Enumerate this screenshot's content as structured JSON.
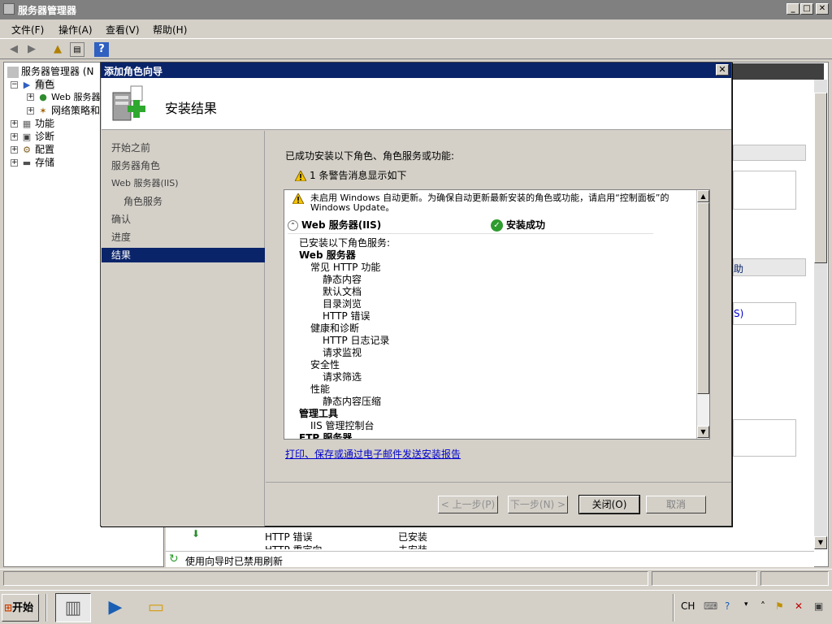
{
  "window": {
    "title": "服务器管理器",
    "menu": [
      "文件(F)",
      "操作(A)",
      "查看(V)",
      "帮助(H)"
    ]
  },
  "tree": {
    "root": "服务器管理器 (N",
    "items": [
      "角色",
      "Web 服务器",
      "网络策略和",
      "功能",
      "诊断",
      "配置",
      "存储"
    ]
  },
  "background": {
    "right_fragment_1": "助",
    "right_fragment_2": "S)",
    "row1_name": "HTTP 错误",
    "row1_status": "已安装",
    "row2_name": "HTTP 重定向",
    "row2_status": "未安装",
    "refresh_notice": "使用向导时已禁用刷新"
  },
  "wizard": {
    "title": "添加角色向导",
    "heading": "安装结果",
    "nav": [
      "开始之前",
      "服务器角色",
      "Web 服务器(IIS)",
      "角色服务",
      "确认",
      "进度",
      "结果"
    ],
    "intro": "已成功安装以下角色、角色服务或功能:",
    "warning_summary": "1 条警告消息显示如下",
    "warning_message": "未启用 Windows 自动更新。为确保自动更新最新安装的角色或功能，请启用“控制面板”的 Windows Update。",
    "section_title": "Web 服务器(IIS)",
    "section_status": "安装成功",
    "details": [
      "已安装以下角色服务:",
      "Web 服务器",
      "常见 HTTP 功能",
      "静态内容",
      "默认文档",
      "目录浏览",
      "HTTP 错误",
      "健康和诊断",
      "HTTP 日志记录",
      "请求监视",
      "安全性",
      "请求筛选",
      "性能",
      "静态内容压缩",
      "管理工具",
      "IIS 管理控制台",
      "FTP 服务器"
    ],
    "report_link": "打印、保存或通过电子邮件发送安装报告",
    "buttons": {
      "prev": "< 上一步(P)",
      "next": "下一步(N) >",
      "close": "关闭(O)",
      "cancel": "取消"
    }
  },
  "taskbar": {
    "start": "开始",
    "lang": "CH"
  },
  "colors": {
    "title_active": "#0a246a",
    "title_inactive": "#808080",
    "link": "#0000cc",
    "success": "#2e9b2e",
    "warning": "#f5c400"
  }
}
